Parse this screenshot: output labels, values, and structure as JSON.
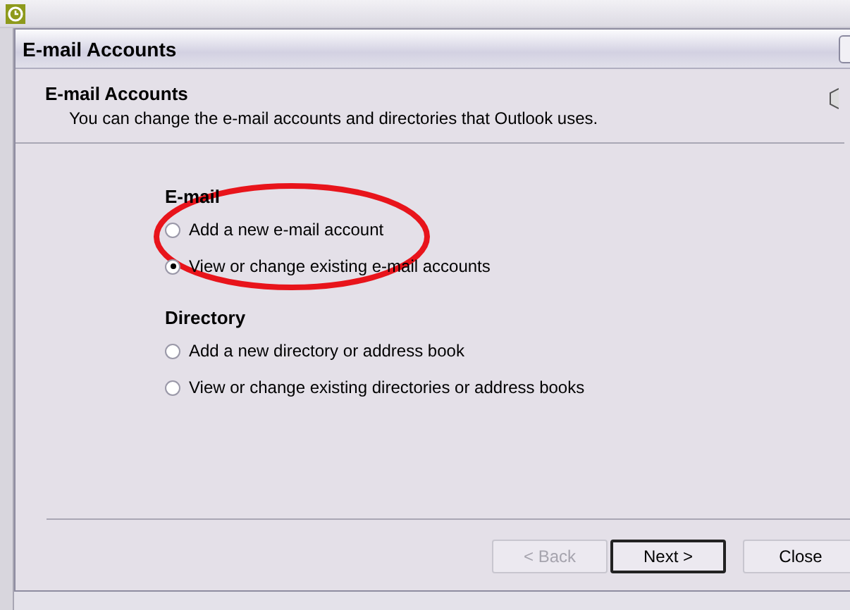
{
  "window": {
    "title": "E-mail Accounts"
  },
  "header": {
    "title": "E-mail Accounts",
    "subtitle": "You can change the e-mail accounts and directories that Outlook uses."
  },
  "groups": [
    {
      "label": "E-mail",
      "options": [
        {
          "label": "Add a new e-mail account",
          "selected": false
        },
        {
          "label": "View or change existing e-mail accounts",
          "selected": true
        }
      ]
    },
    {
      "label": "Directory",
      "options": [
        {
          "label": "Add a new directory or address book",
          "selected": false
        },
        {
          "label": "View or change existing directories or address books",
          "selected": false
        }
      ]
    }
  ],
  "buttons": [
    {
      "label": "< Back",
      "disabled": true,
      "default": false
    },
    {
      "label": "Next >",
      "disabled": false,
      "default": true
    },
    {
      "label": "Close",
      "disabled": false,
      "default": false
    }
  ]
}
